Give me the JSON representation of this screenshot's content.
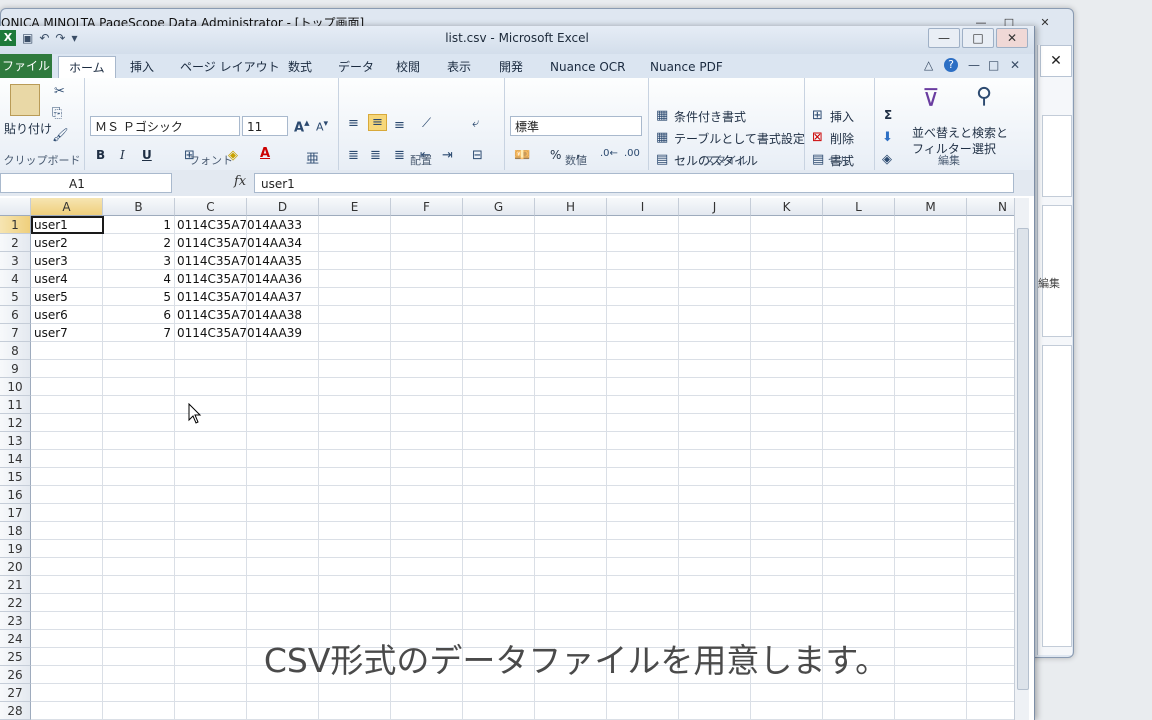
{
  "bg_window": {
    "title": "ONICA MINOLTA PageScope Data Administrator - [トップ画面]",
    "side_label": "編集",
    "close": "✕"
  },
  "excel": {
    "title": "list.csv - Microsoft Excel",
    "qat": {
      "app_icon": "X",
      "undo": "↶",
      "redo": "↷",
      "more": "▾"
    },
    "win_controls": [
      "—",
      "□",
      "✕"
    ],
    "tabs": [
      "ファイル",
      "ホーム",
      "挿入",
      "ページ レイアウト",
      "数式",
      "データ",
      "校閲",
      "表示",
      "開発",
      "Nuance OCR",
      "Nuance PDF"
    ],
    "tab_right_icons": [
      "△",
      "?",
      "—",
      "□",
      "✕"
    ],
    "ribbon": {
      "clipboard": {
        "label": "クリップボード",
        "paste": "貼り付け"
      },
      "font": {
        "label": "フォント",
        "font_name": "ＭＳ Ｐゴシック",
        "font_size": "11",
        "bold": "B",
        "italic": "I",
        "underline": "U"
      },
      "alignment": {
        "label": "配置"
      },
      "number": {
        "label": "数値",
        "format": "標準",
        "percent": "%",
        "comma": ","
      },
      "styles": {
        "label": "スタイル",
        "conditional": "条件付き書式",
        "table": "テーブルとして書式設定",
        "cell_styles": "セルのスタイル"
      },
      "cells": {
        "label": "セル",
        "insert": "挿入",
        "delete": "削除",
        "format": "書式"
      },
      "editing": {
        "label": "編集",
        "sort": "並べ替えと",
        "filter": "フィルター",
        "find": "検索と",
        "select": "選択",
        "sum": "Σ"
      }
    },
    "formula_bar": {
      "name_box": "A1",
      "fx": "fx",
      "value": "user1"
    },
    "columns": [
      "A",
      "B",
      "C",
      "D",
      "E",
      "F",
      "G",
      "H",
      "I",
      "J",
      "K",
      "L",
      "M",
      "N"
    ],
    "row_count": 28,
    "rows": [
      [
        "user1",
        "1",
        "0114C35A7014AA33"
      ],
      [
        "user2",
        "2",
        "0114C35A7014AA34"
      ],
      [
        "user3",
        "3",
        "0114C35A7014AA35"
      ],
      [
        "user4",
        "4",
        "0114C35A7014AA36"
      ],
      [
        "user5",
        "5",
        "0114C35A7014AA37"
      ],
      [
        "user6",
        "6",
        "0114C35A7014AA38"
      ],
      [
        "user7",
        "7",
        "0114C35A7014AA39"
      ]
    ]
  },
  "caption": "CSV形式のデータファイルを用意します。"
}
